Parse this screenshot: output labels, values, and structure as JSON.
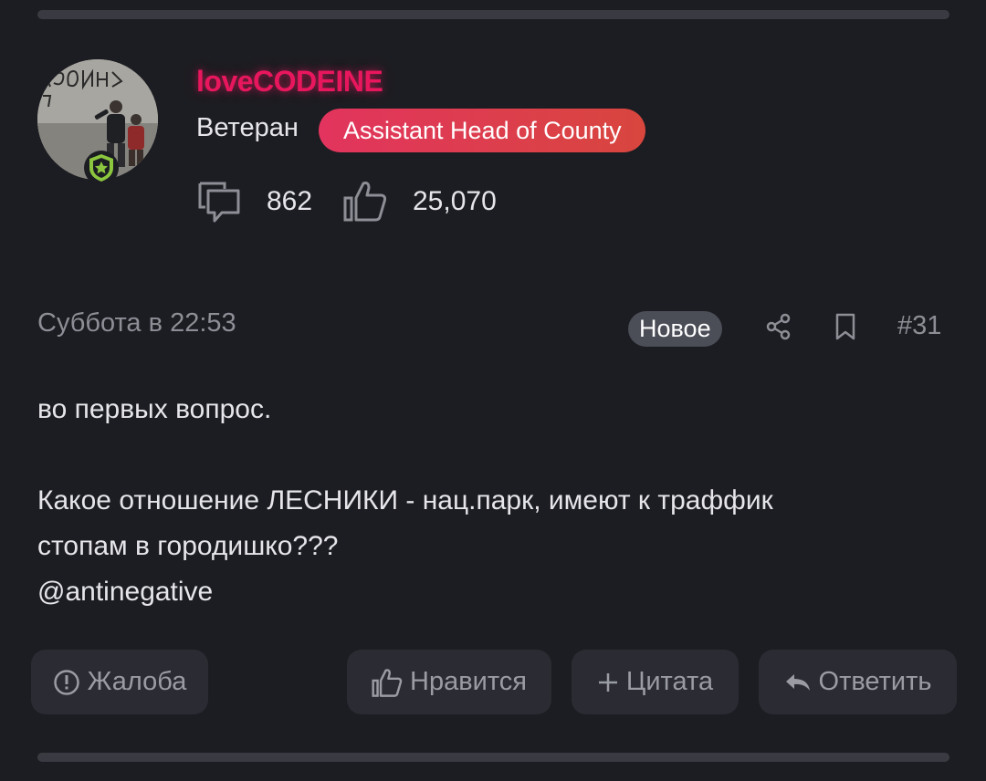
{
  "user": {
    "username": "loveCODEINE",
    "title": "Ветеран",
    "role_badge": "Assistant Head of County",
    "messages_count": "862",
    "likes_count": "25,070"
  },
  "post": {
    "date": "Суббота в 22:53",
    "new_label": "Новое",
    "number": "#31",
    "lines": [
      "во первых вопрос.",
      "Какое отношение ЛЕСНИКИ - нац.парк, имеют к траффик",
      "стопам в городишко???",
      "@antinegative"
    ]
  },
  "actions": {
    "report": "Жалоба",
    "like": "Нравится",
    "quote": "Цитата",
    "reply": "Ответить"
  },
  "icons": {
    "avatar": "avatar-photo",
    "rank": "shield-star-icon",
    "messages": "chat-bubbles-icon",
    "likes": "thumbs-up-icon",
    "share": "share-icon",
    "bookmark": "bookmark-icon",
    "report": "exclamation-circle-icon",
    "quote": "plus-icon",
    "reply": "reply-arrow-icon"
  },
  "colors": {
    "background": "#1c1d22",
    "username": "#e8175d",
    "role_badge_start": "#e2345e",
    "role_badge_end": "#d8463e",
    "rank_badge": "#8cc63f",
    "button_bg": "#2b2c33",
    "muted_text": "#8d8e96"
  }
}
